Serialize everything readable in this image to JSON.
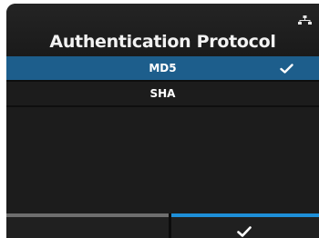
{
  "header": {
    "title": "Authentication Protocol",
    "icons": [
      "network-icon"
    ]
  },
  "options": [
    {
      "label": "MD5",
      "selected": true,
      "checked": true
    },
    {
      "label": "SHA",
      "selected": false,
      "checked": false
    }
  ],
  "softkeys": {
    "left": {
      "label": ""
    },
    "right": {
      "icon": "checkmark-icon"
    }
  },
  "colors": {
    "background": "#1c1c1c",
    "selection": "#1d5e8c",
    "accent": "#1e8fd8",
    "text": "#ffffff"
  }
}
